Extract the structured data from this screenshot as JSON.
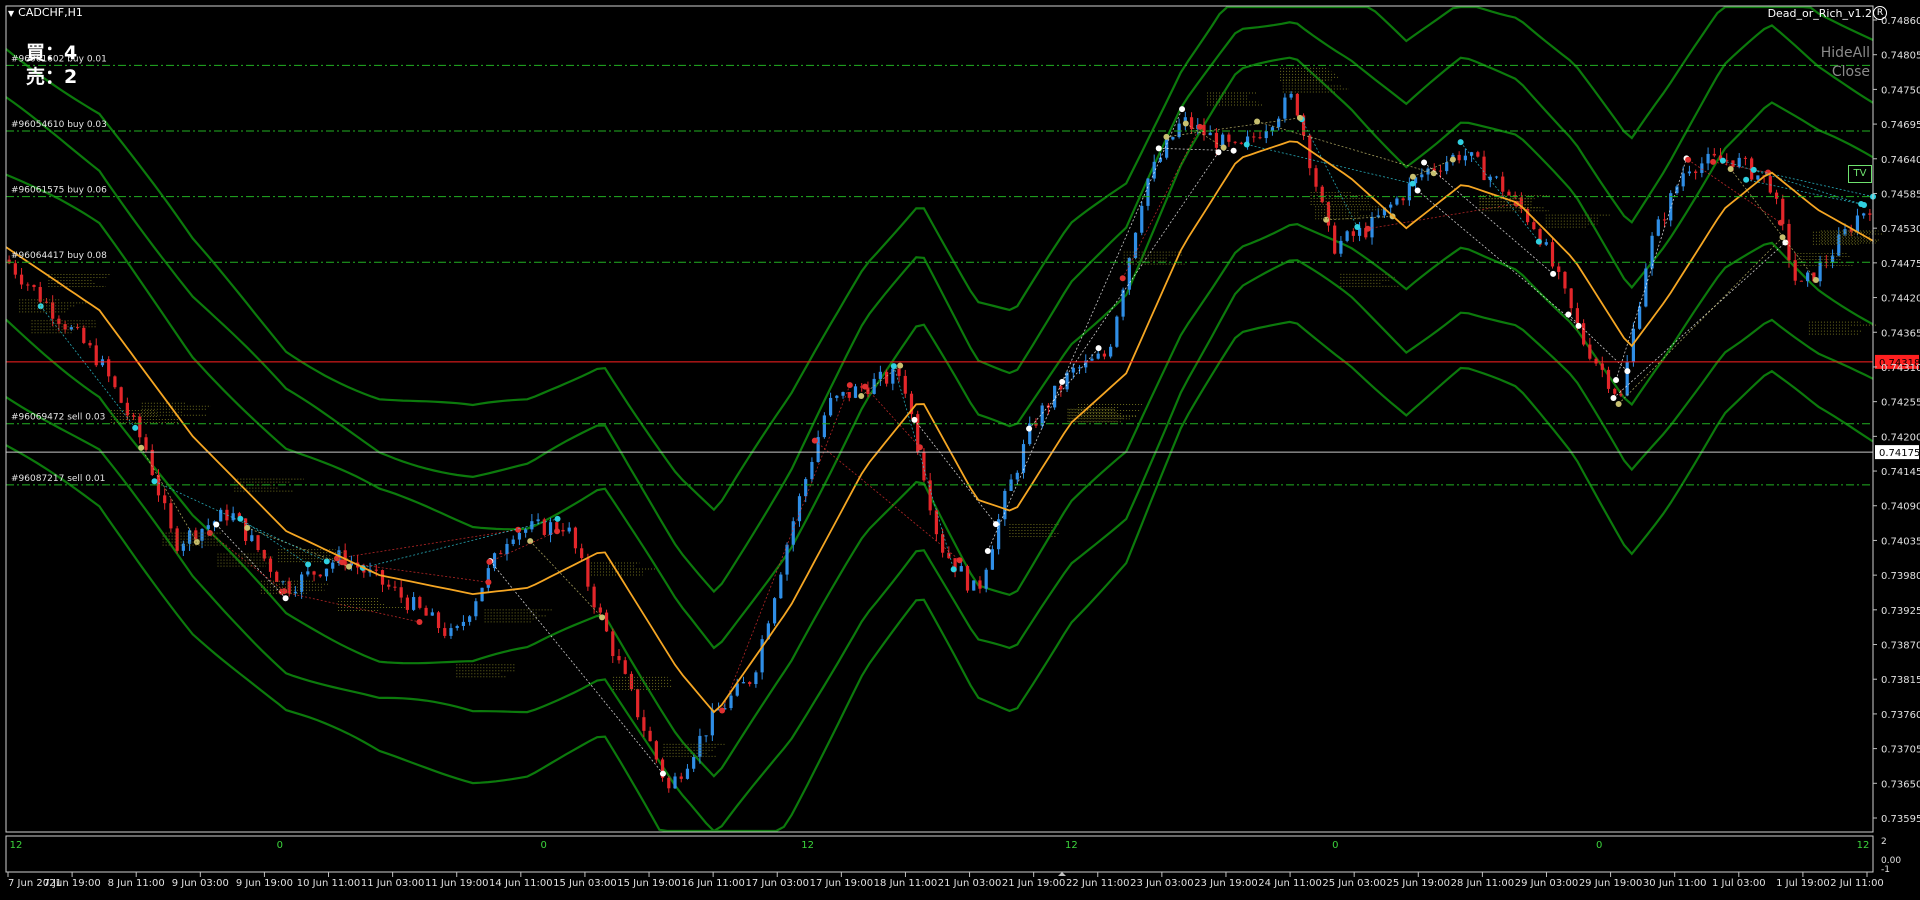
{
  "window": {
    "symbol_title": "CADCHF,H1",
    "ea_name": "Dead_or_Rich_v1.2",
    "ea_icon": "R"
  },
  "counters": {
    "buy": "買：4",
    "sell": "売：2"
  },
  "buttons": {
    "hide_all": "HideAll",
    "close": "Close"
  },
  "tv_badge": "TV",
  "colors": {
    "background": "#000000",
    "bands": "#0c7a0c",
    "ma": "#f5a623",
    "bull": "#2f8ee6",
    "bear": "#e3262a",
    "order_line": "#22b022",
    "current_price": "#ff2020",
    "bid_line": "#c8c8c8"
  },
  "price_axis": {
    "ticks": [
      "0.74860",
      "0.74805",
      "0.74750",
      "0.74695",
      "0.74640",
      "0.74585",
      "0.74530",
      "0.74475",
      "0.74420",
      "0.74365",
      "0.74310",
      "0.74255",
      "0.74200",
      "0.74145",
      "0.74090",
      "0.74035",
      "0.73980",
      "0.73925",
      "0.73870",
      "0.73815",
      "0.73760",
      "0.73705",
      "0.73650",
      "0.73595"
    ],
    "current_price": "0.74318",
    "bid_price": "0.74175"
  },
  "orders": [
    {
      "label": "#96061602 buy 0.01",
      "price": 0.74788
    },
    {
      "label": "#96054610 buy 0.03",
      "price": 0.74684
    },
    {
      "label": "#96061575 buy 0.06",
      "price": 0.7458
    },
    {
      "label": "#96064417 buy 0.08",
      "price": 0.74476
    },
    {
      "label": "#96069472 sell 0.03",
      "price": 0.7422
    },
    {
      "label": "#96087217 sell 0.01",
      "price": 0.74123
    }
  ],
  "subwindow": {
    "labels": [
      "12",
      "0",
      "0",
      "12",
      "12",
      "0",
      "0",
      "12"
    ],
    "axis_ticks": [
      "2",
      "0.00",
      "-1"
    ]
  },
  "time_axis": {
    "labels": [
      "7 Jun 2021",
      "7 Jun 19:00",
      "8 Jun 11:00",
      "9 Jun 03:00",
      "9 Jun 19:00",
      "10 Jun 11:00",
      "11 Jun 03:00",
      "11 Jun 19:00",
      "14 Jun 11:00",
      "15 Jun 03:00",
      "15 Jun 19:00",
      "16 Jun 11:00",
      "17 Jun 03:00",
      "17 Jun 19:00",
      "18 Jun 11:00",
      "21 Jun 03:00",
      "21 Jun 19:00",
      "22 Jun 11:00",
      "23 Jun 03:00",
      "23 Jun 19:00",
      "24 Jun 11:00",
      "25 Jun 03:00",
      "25 Jun 19:00",
      "28 Jun 11:00",
      "29 Jun 03:00",
      "29 Jun 19:00",
      "30 Jun 11:00",
      "1 Jul 03:00",
      "1 Jul 19:00",
      "2 Jul 11:00"
    ]
  },
  "chart_data": {
    "type": "candlestick",
    "symbol": "CADCHF",
    "timeframe": "H1",
    "ylim": [
      0.73595,
      0.7486
    ],
    "price_path": [
      [
        0,
        0.7448
      ],
      [
        0.025,
        0.744
      ],
      [
        0.05,
        0.7432
      ],
      [
        0.075,
        0.7418
      ],
      [
        0.09,
        0.7403
      ],
      [
        0.12,
        0.7408
      ],
      [
        0.15,
        0.7396
      ],
      [
        0.18,
        0.7401
      ],
      [
        0.21,
        0.7395
      ],
      [
        0.24,
        0.7388
      ],
      [
        0.27,
        0.7405
      ],
      [
        0.3,
        0.7406
      ],
      [
        0.32,
        0.739
      ],
      [
        0.34,
        0.7375
      ],
      [
        0.355,
        0.7364
      ],
      [
        0.38,
        0.7376
      ],
      [
        0.4,
        0.7382
      ],
      [
        0.42,
        0.7405
      ],
      [
        0.44,
        0.7425
      ],
      [
        0.46,
        0.7428
      ],
      [
        0.48,
        0.743
      ],
      [
        0.5,
        0.7403
      ],
      [
        0.52,
        0.7395
      ],
      [
        0.535,
        0.741
      ],
      [
        0.55,
        0.7422
      ],
      [
        0.57,
        0.743
      ],
      [
        0.59,
        0.7433
      ],
      [
        0.61,
        0.746
      ],
      [
        0.63,
        0.747
      ],
      [
        0.66,
        0.7465
      ],
      [
        0.69,
        0.7474
      ],
      [
        0.71,
        0.745
      ],
      [
        0.73,
        0.7453
      ],
      [
        0.76,
        0.7462
      ],
      [
        0.78,
        0.7465
      ],
      [
        0.8,
        0.746
      ],
      [
        0.82,
        0.7453
      ],
      [
        0.845,
        0.7435
      ],
      [
        0.865,
        0.7426
      ],
      [
        0.88,
        0.745
      ],
      [
        0.9,
        0.7463
      ],
      [
        0.925,
        0.7464
      ],
      [
        0.945,
        0.746
      ],
      [
        0.96,
        0.7443
      ],
      [
        0.975,
        0.7448
      ],
      [
        0.992,
        0.7455
      ],
      [
        1.0,
        0.7457
      ]
    ],
    "ma_path": [
      [
        0,
        0.745
      ],
      [
        0.05,
        0.744
      ],
      [
        0.1,
        0.742
      ],
      [
        0.15,
        0.7405
      ],
      [
        0.2,
        0.7398
      ],
      [
        0.25,
        0.7395
      ],
      [
        0.28,
        0.7396
      ],
      [
        0.32,
        0.7402
      ],
      [
        0.36,
        0.7383
      ],
      [
        0.38,
        0.7376
      ],
      [
        0.42,
        0.7393
      ],
      [
        0.46,
        0.7415
      ],
      [
        0.49,
        0.7426
      ],
      [
        0.52,
        0.741
      ],
      [
        0.54,
        0.7408
      ],
      [
        0.57,
        0.7422
      ],
      [
        0.6,
        0.743
      ],
      [
        0.63,
        0.745
      ],
      [
        0.66,
        0.7464
      ],
      [
        0.69,
        0.7467
      ],
      [
        0.72,
        0.7461
      ],
      [
        0.75,
        0.7453
      ],
      [
        0.78,
        0.746
      ],
      [
        0.81,
        0.7457
      ],
      [
        0.84,
        0.7448
      ],
      [
        0.87,
        0.7434
      ],
      [
        0.89,
        0.7442
      ],
      [
        0.92,
        0.7456
      ],
      [
        0.945,
        0.7462
      ],
      [
        0.97,
        0.7456
      ],
      [
        1.0,
        0.7451
      ]
    ],
    "band_offsets": [
      0.00095,
      0.0019,
      0.00285
    ]
  }
}
